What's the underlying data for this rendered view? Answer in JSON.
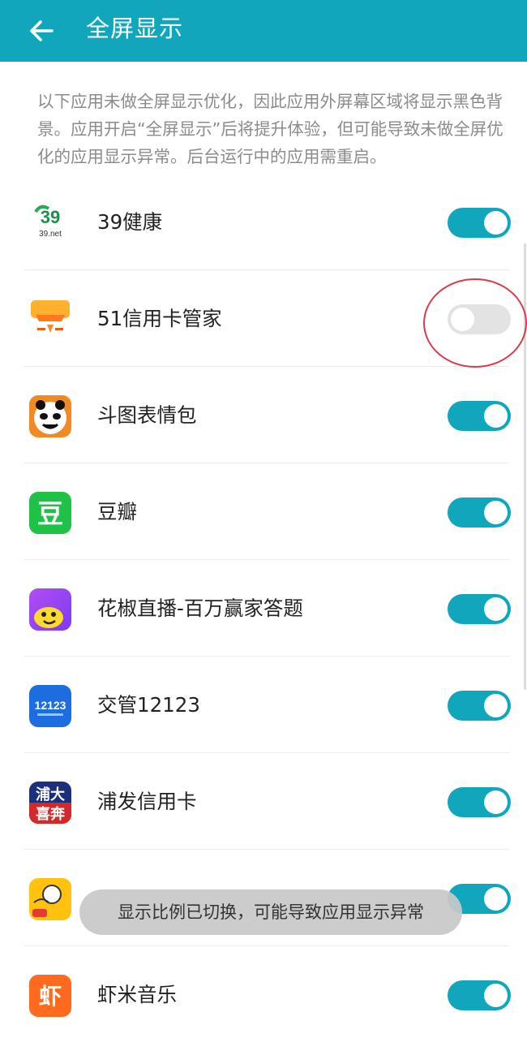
{
  "header": {
    "title": "全屏显示",
    "back_icon": "arrow-left-icon",
    "color": "#10a7bd"
  },
  "description": "以下应用未做全屏显示优化，因此应用外屏幕区域将显示黑色背景。应用开启“全屏显示”后将提升体验，但可能导致未做全屏优化的应用显示异常。后台运行中的应用需重启。",
  "apps": [
    {
      "name": "39健康",
      "icon": "39-health-icon",
      "enabled": true
    },
    {
      "name": "51信用卡管家",
      "icon": "51-credit-card-icon",
      "enabled": false
    },
    {
      "name": "斗图表情包",
      "icon": "meme-panda-icon",
      "enabled": true
    },
    {
      "name": "豆瓣",
      "icon": "douban-icon",
      "enabled": true
    },
    {
      "name": "花椒直播-百万赢家答题",
      "icon": "huajiao-live-icon",
      "enabled": true
    },
    {
      "name": "交管12123",
      "icon": "traffic-12123-icon",
      "enabled": true
    },
    {
      "name": "浦发信用卡",
      "icon": "spdb-credit-card-icon",
      "enabled": true
    },
    {
      "name": "",
      "icon": "yellow-character-icon",
      "enabled": true
    },
    {
      "name": "虾米音乐",
      "icon": "xiami-music-icon",
      "enabled": true
    }
  ],
  "icon_texts": {
    "health_net": "39.net",
    "douban_char": "豆",
    "traffic_num": "12123",
    "spdb_chars": "浦大",
    "spdb_chars2": "喜奔",
    "xiami_char": "虾"
  },
  "toast": "显示比例已切换，可能导致应用显示异常",
  "toggle_on_color": "#10a7bd",
  "toggle_off_color": "#e3e3e3"
}
